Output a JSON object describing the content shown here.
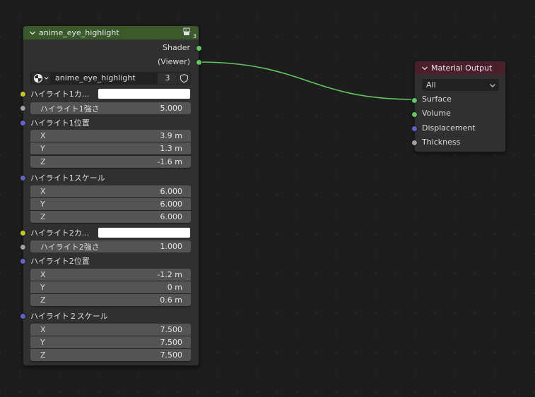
{
  "group_node": {
    "title": "anime_eye_highlight",
    "user_count_badge": "3",
    "outputs": [
      "Shader",
      "(Viewer)"
    ],
    "datablock": {
      "name": "anime_eye_highlight",
      "users": "3"
    },
    "inputs": {
      "h1_color_label": "ハイライト1カ...",
      "h1_strength": {
        "label": "ハイライト1強さ",
        "value": "5.000"
      },
      "h1_position": {
        "label": "ハイライト1位置",
        "x": {
          "label": "X",
          "value": "3.9 m"
        },
        "y": {
          "label": "Y",
          "value": "1.3 m"
        },
        "z": {
          "label": "Z",
          "value": "-1.6 m"
        }
      },
      "h1_scale": {
        "label": "ハイライト1スケール",
        "x": {
          "label": "X",
          "value": "6.000"
        },
        "y": {
          "label": "Y",
          "value": "6.000"
        },
        "z": {
          "label": "Z",
          "value": "6.000"
        }
      },
      "h2_color_label": "ハイライト2カ...",
      "h2_strength": {
        "label": "ハイライト2強さ",
        "value": "1.000"
      },
      "h2_position": {
        "label": "ハイライト2位置",
        "x": {
          "label": "X",
          "value": "-1.2 m"
        },
        "y": {
          "label": "Y",
          "value": "0 m"
        },
        "z": {
          "label": "Z",
          "value": "0.6 m"
        }
      },
      "h2_scale": {
        "label": "ハイライト２スケール",
        "x": {
          "label": "X",
          "value": "7.500"
        },
        "y": {
          "label": "Y",
          "value": "7.500"
        },
        "z": {
          "label": "Z",
          "value": "7.500"
        }
      }
    }
  },
  "output_node": {
    "title": "Material Output",
    "target": "All",
    "inputs": [
      "Surface",
      "Volume",
      "Displacement",
      "Thickness"
    ]
  },
  "colors": {
    "group_header": "#3b5a2c",
    "output_header": "#4b1f2b",
    "link": "#63c763",
    "socket_shader": "#63c763",
    "socket_color": "#c7c729",
    "socket_float": "#a1a1a1",
    "socket_vector": "#6363c7"
  }
}
